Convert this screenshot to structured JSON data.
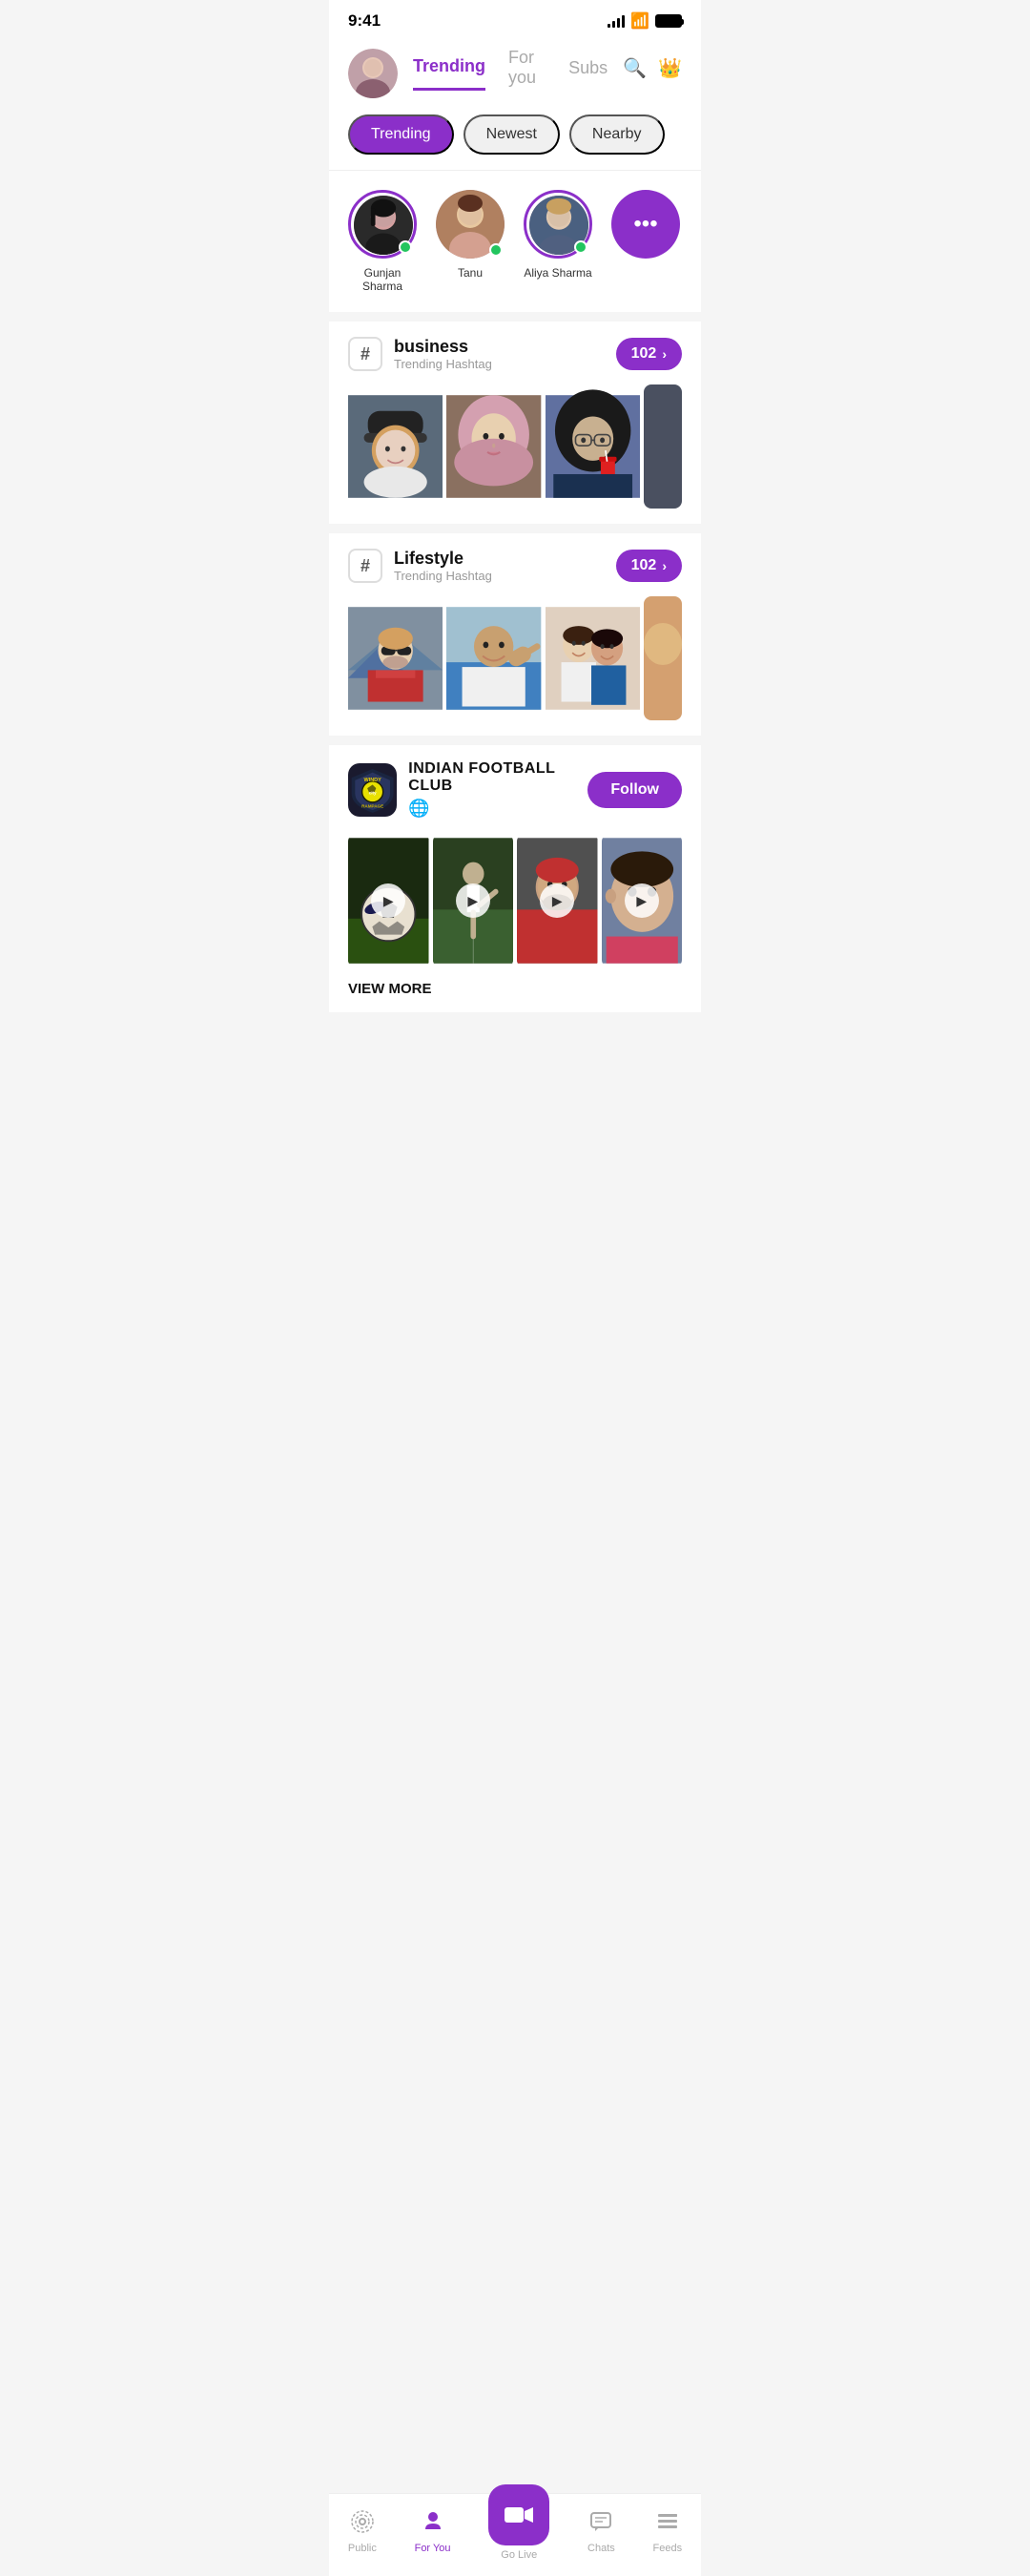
{
  "status": {
    "time": "9:41"
  },
  "header": {
    "tabs": [
      {
        "label": "Trending",
        "active": true
      },
      {
        "label": "For you",
        "active": false
      },
      {
        "label": "Subs",
        "active": false
      }
    ]
  },
  "filters": [
    {
      "label": "Trending",
      "active": true
    },
    {
      "label": "Newest",
      "active": false
    },
    {
      "label": "Nearby",
      "active": false
    }
  ],
  "stories": [
    {
      "name": "Gunjan Sharma",
      "online": true
    },
    {
      "name": "Tanu",
      "online": true
    },
    {
      "name": "Aliya Sharma",
      "online": true
    }
  ],
  "hashtags": [
    {
      "tag": "business",
      "subtitle": "Trending Hashtag",
      "count": "102"
    },
    {
      "tag": "Lifestyle",
      "subtitle": "Trending Hashtag",
      "count": "102"
    }
  ],
  "club": {
    "name": "INDIAN FOOTBALL CLUB",
    "logo_text": "WINDY city",
    "globe": "🌐",
    "follow_label": "Follow",
    "view_more_label": "VIEW MORE"
  },
  "bottom_nav": {
    "items": [
      {
        "label": "Public",
        "icon": "📻",
        "active": false
      },
      {
        "label": "For You",
        "icon": "👤",
        "active": true
      },
      {
        "label": "Go Live",
        "icon": "📹",
        "active": false,
        "is_center": true
      },
      {
        "label": "Chats",
        "icon": "💬",
        "active": false
      },
      {
        "label": "Feeds",
        "icon": "☰",
        "active": false
      }
    ]
  }
}
